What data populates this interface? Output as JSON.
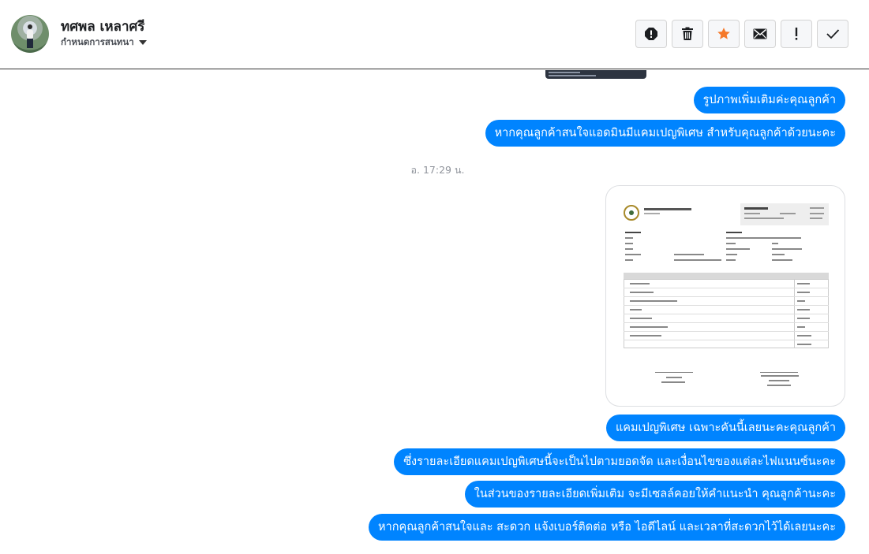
{
  "header": {
    "contact_name": "ทศพล เหลาศรี",
    "subtitle": "กำหนดการสนทนา",
    "avatar_icon": "person-photo",
    "actions": [
      {
        "name": "spam-button",
        "icon": "exclamation-circle-icon"
      },
      {
        "name": "delete-button",
        "icon": "trash-icon"
      },
      {
        "name": "star-button",
        "icon": "star-icon",
        "color": "#f5792a"
      },
      {
        "name": "mark-unread-button",
        "icon": "envelope-icon"
      },
      {
        "name": "important-button",
        "icon": "exclamation-icon"
      },
      {
        "name": "done-button",
        "icon": "check-icon"
      }
    ]
  },
  "colors": {
    "bubble": "#0084ff",
    "star": "#f5792a",
    "timestamp": "#90949c"
  },
  "messages_before": [
    "รูปภาพเพิ่มเติมค่ะคุณลูกค้า",
    "หากคุณลูกค้าสนใจแอดมินมีแคมเปญพิเศษ สำหรับคุณลูกค้าด้วยนะคะ"
  ],
  "timestamp": "อ. 17:29 น.",
  "attachment": {
    "type": "image",
    "description_icon": "quotation-document-thumbnail"
  },
  "messages_after": [
    "แคมเปญพิเศษ เฉพาะคันนี้เลยนะคะคุณลูกค้า",
    "ซึ่งรายละเอียดแคมเปญพิเศษนี้จะเป็นไปตามยอดจัด และเงื่อนไขของแต่ละไฟแนนซ์นะคะ",
    "ในส่วนของรายละเอียดเพิ่มเติม จะมีเซลล์คอยให้คำแนะนำ คุณลูกค้านะคะ",
    "หากคุณลูกค้าสนใจและ สะดวก แจ้งเบอร์ติดต่อ หรือ ไอดีไลน์ และเวลาที่สะดวกไว้ได้เลยนะคะ"
  ]
}
